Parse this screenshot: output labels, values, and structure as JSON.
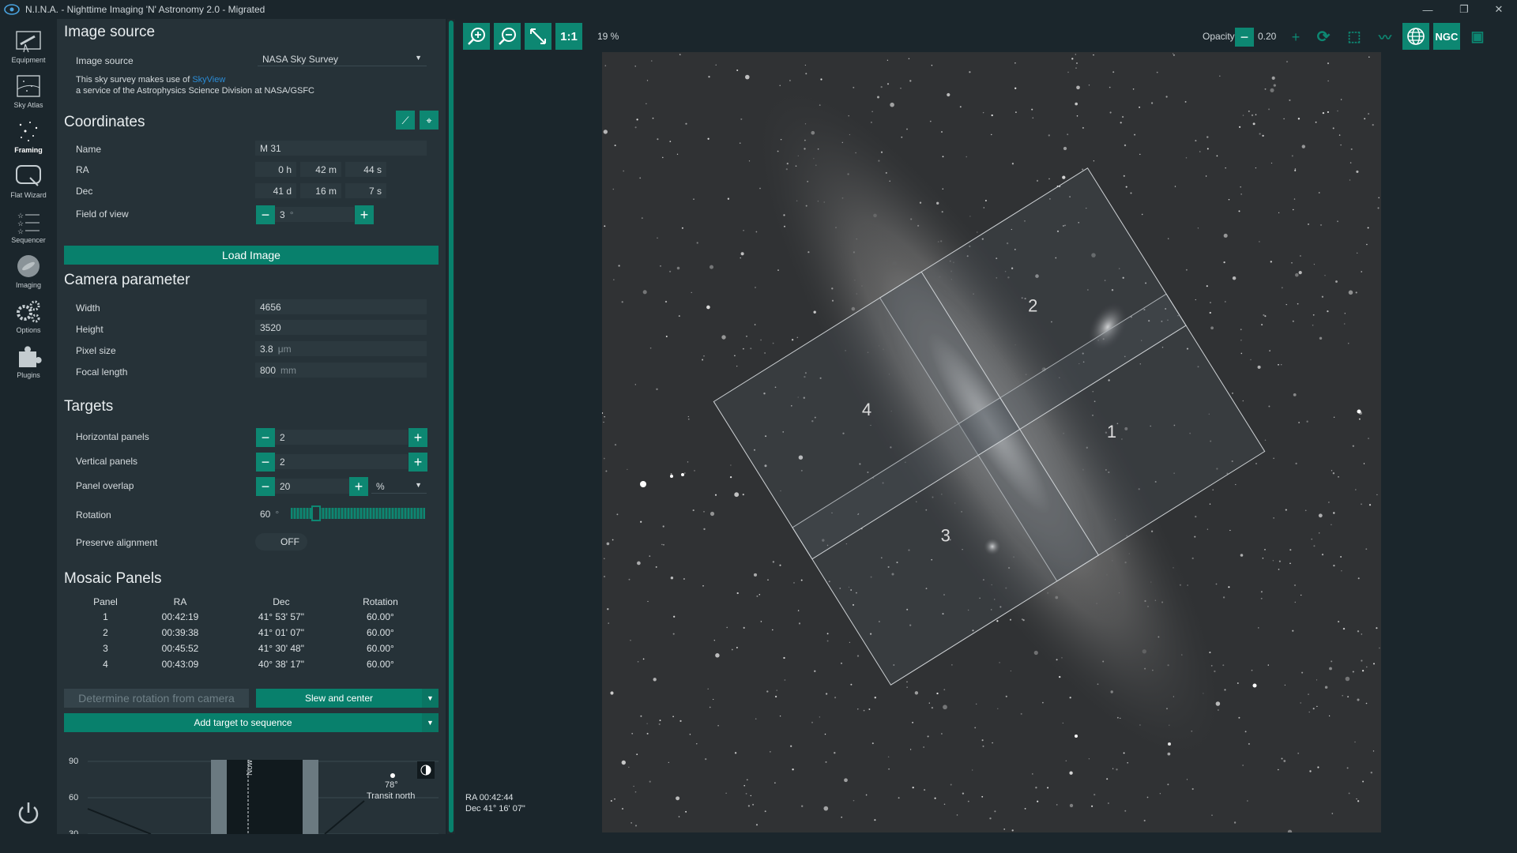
{
  "window": {
    "title": "N.I.N.A. - Nighttime Imaging 'N' Astronomy 2.0  -  Migrated"
  },
  "nav": {
    "items": [
      {
        "label": "Equipment",
        "icon": "telescope-icon"
      },
      {
        "label": "Sky Atlas",
        "icon": "atlas-icon"
      },
      {
        "label": "Framing",
        "icon": "framing-icon"
      },
      {
        "label": "Flat Wizard",
        "icon": "flat-wizard-icon"
      },
      {
        "label": "Sequencer",
        "icon": "sequencer-icon"
      },
      {
        "label": "Imaging",
        "icon": "imaging-icon"
      },
      {
        "label": "Options",
        "icon": "gear-icon"
      },
      {
        "label": "Plugins",
        "icon": "puzzle-icon"
      }
    ],
    "active": "Framing"
  },
  "image_source": {
    "heading": "Image source",
    "label": "Image source",
    "value": "NASA Sky Survey",
    "note_prefix": "This sky survey makes use of ",
    "note_link": "SkyView",
    "note_suffix": " a service of the Astrophysics Science Division at NASA/GSFC"
  },
  "coordinates": {
    "heading": "Coordinates",
    "name_label": "Name",
    "name_value": "M 31",
    "ra_label": "RA",
    "ra_h": "0",
    "ra_h_unit": "h",
    "ra_m": "42",
    "ra_m_unit": "m",
    "ra_s": "44",
    "ra_s_unit": "s",
    "dec_label": "Dec",
    "dec_d": "41",
    "dec_d_unit": "d",
    "dec_m": "16",
    "dec_m_unit": "m",
    "dec_s": "7",
    "dec_s_unit": "s",
    "fov_label": "Field of view",
    "fov_value": "3",
    "fov_unit": "°"
  },
  "load_image_label": "Load Image",
  "camera": {
    "heading": "Camera parameter",
    "width_label": "Width",
    "width_value": "4656",
    "height_label": "Height",
    "height_value": "3520",
    "pixel_label": "Pixel size",
    "pixel_value": "3.8",
    "pixel_unit": "μm",
    "focal_label": "Focal length",
    "focal_value": "800",
    "focal_unit": "mm"
  },
  "targets": {
    "heading": "Targets",
    "hpanels_label": "Horizontal panels",
    "hpanels_value": "2",
    "vpanels_label": "Vertical panels",
    "vpanels_value": "2",
    "overlap_label": "Panel overlap",
    "overlap_value": "20",
    "overlap_unit": "%",
    "rotation_label": "Rotation",
    "rotation_value": "60",
    "rotation_unit": "°",
    "preserve_label": "Preserve alignment",
    "preserve_value": "OFF"
  },
  "mosaic": {
    "heading": "Mosaic Panels",
    "columns": [
      "Panel",
      "RA",
      "Dec",
      "Rotation"
    ],
    "rows": [
      [
        "1",
        "00:42:19",
        "41° 53' 57\"",
        "60.00°"
      ],
      [
        "2",
        "00:39:38",
        "41° 01' 07\"",
        "60.00°"
      ],
      [
        "3",
        "00:45:52",
        "41° 30' 48\"",
        "60.00°"
      ],
      [
        "4",
        "00:43:09",
        "40° 38' 17\"",
        "60.00°"
      ]
    ]
  },
  "actions": {
    "determine_rotation": "Determine rotation from camera",
    "slew_center": "Slew and center",
    "add_target": "Add target to sequence"
  },
  "altitude_chart": {
    "y_ticks": [
      "90",
      "60",
      "30"
    ],
    "now_label": "Now",
    "transit_value": "78°",
    "transit_label": "Transit north"
  },
  "viewer": {
    "zoom": "19 %",
    "one_to_one": "1:1",
    "opacity_label": "Opacity",
    "opacity_value": "0.20",
    "ngc_label": "NGC",
    "cursor_ra": "RA 00:42:44",
    "cursor_dec": "Dec 41° 16' 07\"",
    "panel_numbers": [
      "1",
      "2",
      "3",
      "4"
    ]
  },
  "colors": {
    "accent": "#0d8772",
    "panel_bg": "#263238",
    "app_bg": "#1b262c"
  }
}
